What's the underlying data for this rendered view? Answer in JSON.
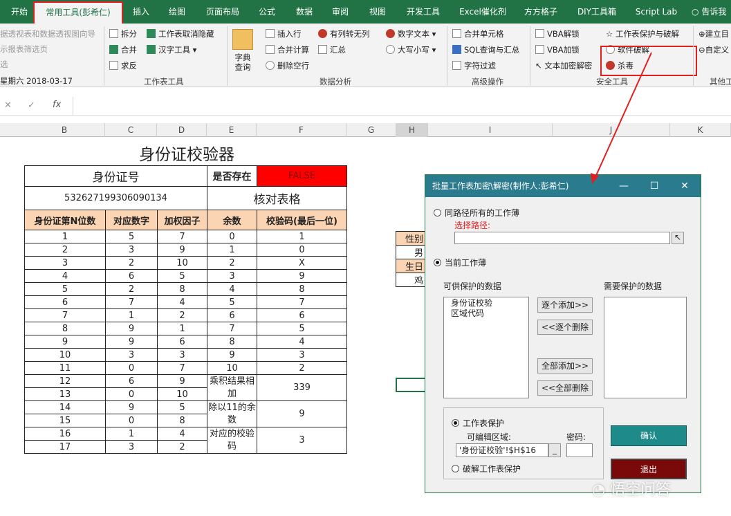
{
  "tabs": [
    "开始",
    "常用工具(彭希仁)",
    "插入",
    "绘图",
    "页面布局",
    "公式",
    "数据",
    "审阅",
    "视图",
    "开发工具",
    "Excel催化剂",
    "方方格子",
    "DIY工具箱",
    "Script Lab",
    "告诉我"
  ],
  "ribbon": {
    "left_items": [
      "据透视表和数据透视图向导",
      "示报表筛选页",
      "选",
      "星期六 2018-03-17"
    ],
    "worksheet_tools": [
      "拆分",
      "工作表取消隐藏",
      "合并",
      "汉字工具",
      "求反"
    ],
    "dict_query": "字典查询",
    "data_analysis": [
      "插入行",
      "有列转无列",
      "合并计算",
      "汇总",
      "删除空行",
      "数字文本",
      "大写小写"
    ],
    "advanced": [
      "合并单元格",
      "SQL查询与汇总",
      "字符过滤"
    ],
    "security": [
      "VBA解锁",
      "工作表保护与破解",
      "VBA加锁",
      "软件破解",
      "文本加密解密",
      "杀毒"
    ],
    "other": [
      "建立目",
      "自定义"
    ],
    "groups": [
      "工作表工具",
      "数据分析",
      "高级操作",
      "安全工具",
      "其他工"
    ]
  },
  "formula_bar": {
    "cancel": "✕",
    "enter": "✓",
    "fx": "fx"
  },
  "columns": [
    "B",
    "C",
    "D",
    "E",
    "F",
    "G",
    "H",
    "I",
    "J",
    "K"
  ],
  "sheet": {
    "title": "身份证校验器",
    "id_label": "身份证号",
    "exists_label": "是否存在",
    "exists_value": "FALSE",
    "id_value": "532627199306090134",
    "check_table": "核对表格",
    "headers": [
      "身份证第N位数",
      "对应数字",
      "加权因子",
      "余数",
      "校验码(最后一位)"
    ],
    "rows": [
      [
        1,
        5,
        7
      ],
      [
        2,
        3,
        9
      ],
      [
        3,
        2,
        10
      ],
      [
        4,
        6,
        5
      ],
      [
        5,
        2,
        8
      ],
      [
        6,
        7,
        4
      ],
      [
        7,
        1,
        2
      ],
      [
        8,
        9,
        1
      ],
      [
        9,
        9,
        6
      ],
      [
        10,
        3,
        3
      ],
      [
        11,
        0,
        7
      ],
      [
        12,
        6,
        9
      ],
      [
        13,
        0,
        10
      ],
      [
        14,
        9,
        5
      ],
      [
        15,
        0,
        8
      ],
      [
        16,
        1,
        4
      ],
      [
        17,
        3,
        2
      ]
    ],
    "remainders": [
      [
        0,
        "1"
      ],
      [
        1,
        "0"
      ],
      [
        2,
        "X"
      ],
      [
        3,
        "9"
      ],
      [
        4,
        "8"
      ],
      [
        5,
        "7"
      ],
      [
        6,
        "6"
      ],
      [
        7,
        "5"
      ],
      [
        8,
        "4"
      ],
      [
        9,
        "3"
      ],
      [
        10,
        "2"
      ]
    ],
    "summary": [
      [
        "乘积结果相加",
        "339"
      ],
      [
        "除以11的余数",
        "9"
      ],
      [
        "对应的校验码",
        "3"
      ]
    ],
    "mini": [
      "性别",
      "男",
      "生日",
      "鸡"
    ]
  },
  "dialog": {
    "title": "批量工作表加密\\解密(制作人:彭希仁)",
    "opt_same_path": "同路径所有的工作薄",
    "select_path": "选择路径:",
    "opt_current": "当前工作薄",
    "available": "可供保护的数据",
    "needed": "需要保护的数据",
    "list_items": [
      "身份证校验",
      "区域代码"
    ],
    "btn_add_one": "逐个添加>>",
    "btn_del_one": "<<逐个删除",
    "btn_add_all": "全部添加>>",
    "btn_del_all": "<<全部删除",
    "opt_protect": "工作表保护",
    "editable_range": "可编辑区域:",
    "range_value": "'身份证校验'!$H$16",
    "password": "密码:",
    "opt_crack": "破解工作表保护",
    "btn_confirm": "确认",
    "btn_exit": "退出"
  },
  "watermark": "悟空问答"
}
